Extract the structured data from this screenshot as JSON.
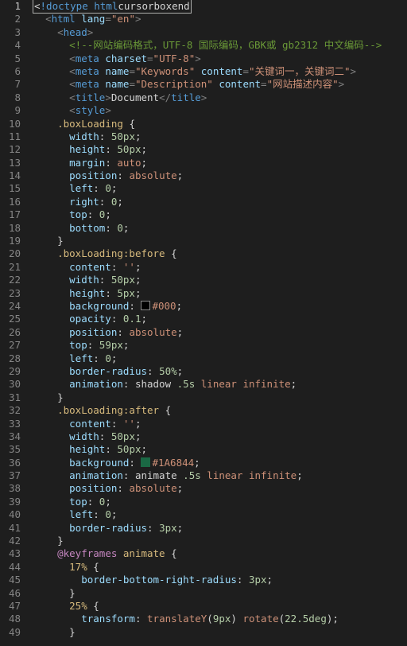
{
  "editor": {
    "line_count": 49,
    "cursor_line": 1,
    "indent_unit": "  ",
    "tokens": [
      [
        [
          0,
          "cursorbox",
          "<"
        ],
        [
          "doctype",
          "!doctype html"
        ],
        [
          0,
          "cursorboxend",
          ">"
        ]
      ],
      [
        [
          1,
          "punct",
          "<"
        ],
        [
          "tag",
          "html"
        ],
        [
          "plain",
          " "
        ],
        [
          "attr",
          "lang"
        ],
        [
          "punct",
          "="
        ],
        [
          "string",
          "\"en\""
        ],
        [
          "punct",
          ">"
        ]
      ],
      [
        [
          2,
          "punct",
          "<"
        ],
        [
          "tag",
          "head"
        ],
        [
          "punct",
          ">"
        ]
      ],
      [
        [
          3,
          "comment",
          "<!--网站编码格式，UTF-8 国际编码，GBK或 gb2312 中文编码-->"
        ]
      ],
      [
        [
          3,
          "punct",
          "<"
        ],
        [
          "tag",
          "meta"
        ],
        [
          "plain",
          " "
        ],
        [
          "attr",
          "charset"
        ],
        [
          "punct",
          "="
        ],
        [
          "string",
          "\"UTF-8\""
        ],
        [
          "punct",
          ">"
        ]
      ],
      [
        [
          3,
          "punct",
          "<"
        ],
        [
          "tag",
          "meta"
        ],
        [
          "plain",
          " "
        ],
        [
          "attr",
          "name"
        ],
        [
          "punct",
          "="
        ],
        [
          "string",
          "\"Keywords\""
        ],
        [
          "plain",
          " "
        ],
        [
          "attr",
          "content"
        ],
        [
          "punct",
          "="
        ],
        [
          "string",
          "\"关键词一，关键词二\""
        ],
        [
          "punct",
          ">"
        ]
      ],
      [
        [
          3,
          "punct",
          "<"
        ],
        [
          "tag",
          "meta"
        ],
        [
          "plain",
          " "
        ],
        [
          "attr",
          "name"
        ],
        [
          "punct",
          "="
        ],
        [
          "string",
          "\"Description\""
        ],
        [
          "plain",
          " "
        ],
        [
          "attr",
          "content"
        ],
        [
          "punct",
          "="
        ],
        [
          "string",
          "\"网站描述内容\""
        ],
        [
          "punct",
          ">"
        ]
      ],
      [
        [
          3,
          "punct",
          "<"
        ],
        [
          "tag",
          "title"
        ],
        [
          "punct",
          ">"
        ],
        [
          "plain",
          "Document"
        ],
        [
          "punct",
          "</"
        ],
        [
          "tag",
          "title"
        ],
        [
          "punct",
          ">"
        ]
      ],
      [
        [
          3,
          "punct",
          "<"
        ],
        [
          "tag",
          "style"
        ],
        [
          "punct",
          ">"
        ]
      ],
      [
        [
          2,
          "selector",
          ".boxLoading"
        ],
        [
          "plain",
          " "
        ],
        [
          "brace",
          "{"
        ]
      ],
      [
        [
          3,
          "prop",
          "width"
        ],
        [
          "colon",
          ": "
        ],
        [
          "num",
          "50"
        ],
        [
          "unit",
          "px"
        ],
        [
          "plain",
          ";"
        ]
      ],
      [
        [
          3,
          "prop",
          "height"
        ],
        [
          "colon",
          ": "
        ],
        [
          "num",
          "50"
        ],
        [
          "unit",
          "px"
        ],
        [
          "plain",
          ";"
        ]
      ],
      [
        [
          3,
          "prop",
          "margin"
        ],
        [
          "colon",
          ": "
        ],
        [
          "val",
          "auto"
        ],
        [
          "plain",
          ";"
        ]
      ],
      [
        [
          3,
          "prop",
          "position"
        ],
        [
          "colon",
          ": "
        ],
        [
          "val",
          "absolute"
        ],
        [
          "plain",
          ";"
        ]
      ],
      [
        [
          3,
          "prop",
          "left"
        ],
        [
          "colon",
          ": "
        ],
        [
          "num",
          "0"
        ],
        [
          "plain",
          ";"
        ]
      ],
      [
        [
          3,
          "prop",
          "right"
        ],
        [
          "colon",
          ": "
        ],
        [
          "num",
          "0"
        ],
        [
          "plain",
          ";"
        ]
      ],
      [
        [
          3,
          "prop",
          "top"
        ],
        [
          "colon",
          ": "
        ],
        [
          "num",
          "0"
        ],
        [
          "plain",
          ";"
        ]
      ],
      [
        [
          3,
          "prop",
          "bottom"
        ],
        [
          "colon",
          ": "
        ],
        [
          "num",
          "0"
        ],
        [
          "plain",
          ";"
        ]
      ],
      [
        [
          2,
          "brace",
          "}"
        ]
      ],
      [
        [
          2,
          "selector",
          ".boxLoading:before"
        ],
        [
          "plain",
          " "
        ],
        [
          "brace",
          "{"
        ]
      ],
      [
        [
          3,
          "prop",
          "content"
        ],
        [
          "colon",
          ": "
        ],
        [
          "val",
          "''"
        ],
        [
          "plain",
          ";"
        ]
      ],
      [
        [
          3,
          "prop",
          "width"
        ],
        [
          "colon",
          ": "
        ],
        [
          "num",
          "50"
        ],
        [
          "unit",
          "px"
        ],
        [
          "plain",
          ";"
        ]
      ],
      [
        [
          3,
          "prop",
          "height"
        ],
        [
          "colon",
          ": "
        ],
        [
          "num",
          "5"
        ],
        [
          "unit",
          "px"
        ],
        [
          "plain",
          ";"
        ]
      ],
      [
        [
          3,
          "prop",
          "background"
        ],
        [
          "colon",
          ": "
        ],
        [
          "swatch",
          "black"
        ],
        [
          "hex",
          "#000"
        ],
        [
          "plain",
          ";"
        ]
      ],
      [
        [
          3,
          "prop",
          "opacity"
        ],
        [
          "colon",
          ": "
        ],
        [
          "num",
          "0.1"
        ],
        [
          "plain",
          ";"
        ]
      ],
      [
        [
          3,
          "prop",
          "position"
        ],
        [
          "colon",
          ": "
        ],
        [
          "val",
          "absolute"
        ],
        [
          "plain",
          ";"
        ]
      ],
      [
        [
          3,
          "prop",
          "top"
        ],
        [
          "colon",
          ": "
        ],
        [
          "num",
          "59"
        ],
        [
          "unit",
          "px"
        ],
        [
          "plain",
          ";"
        ]
      ],
      [
        [
          3,
          "prop",
          "left"
        ],
        [
          "colon",
          ": "
        ],
        [
          "num",
          "0"
        ],
        [
          "plain",
          ";"
        ]
      ],
      [
        [
          3,
          "prop",
          "border-radius"
        ],
        [
          "colon",
          ": "
        ],
        [
          "num",
          "50"
        ],
        [
          "unit",
          "%"
        ],
        [
          "plain",
          ";"
        ]
      ],
      [
        [
          3,
          "prop",
          "animation"
        ],
        [
          "colon",
          ": "
        ],
        [
          "plain",
          "shadow "
        ],
        [
          "num",
          ".5"
        ],
        [
          "unit",
          "s"
        ],
        [
          "plain",
          " "
        ],
        [
          "val",
          "linear"
        ],
        [
          "plain",
          " "
        ],
        [
          "val",
          "infinite"
        ],
        [
          "plain",
          ";"
        ]
      ],
      [
        [
          2,
          "brace",
          "}"
        ]
      ],
      [
        [
          2,
          "selector",
          ".boxLoading:after"
        ],
        [
          "plain",
          " "
        ],
        [
          "brace",
          "{"
        ]
      ],
      [
        [
          3,
          "prop",
          "content"
        ],
        [
          "colon",
          ": "
        ],
        [
          "val",
          "''"
        ],
        [
          "plain",
          ";"
        ]
      ],
      [
        [
          3,
          "prop",
          "width"
        ],
        [
          "colon",
          ": "
        ],
        [
          "num",
          "50"
        ],
        [
          "unit",
          "px"
        ],
        [
          "plain",
          ";"
        ]
      ],
      [
        [
          3,
          "prop",
          "height"
        ],
        [
          "colon",
          ": "
        ],
        [
          "num",
          "50"
        ],
        [
          "unit",
          "px"
        ],
        [
          "plain",
          ";"
        ]
      ],
      [
        [
          3,
          "prop",
          "background"
        ],
        [
          "colon",
          ": "
        ],
        [
          "swatch",
          "green"
        ],
        [
          "hex",
          "#1A6844"
        ],
        [
          "plain",
          ";"
        ]
      ],
      [
        [
          3,
          "prop",
          "animation"
        ],
        [
          "colon",
          ": "
        ],
        [
          "plain",
          "animate "
        ],
        [
          "num",
          ".5"
        ],
        [
          "unit",
          "s"
        ],
        [
          "plain",
          " "
        ],
        [
          "val",
          "linear"
        ],
        [
          "plain",
          " "
        ],
        [
          "val",
          "infinite"
        ],
        [
          "plain",
          ";"
        ]
      ],
      [
        [
          3,
          "prop",
          "position"
        ],
        [
          "colon",
          ": "
        ],
        [
          "val",
          "absolute"
        ],
        [
          "plain",
          ";"
        ]
      ],
      [
        [
          3,
          "prop",
          "top"
        ],
        [
          "colon",
          ": "
        ],
        [
          "num",
          "0"
        ],
        [
          "plain",
          ";"
        ]
      ],
      [
        [
          3,
          "prop",
          "left"
        ],
        [
          "colon",
          ": "
        ],
        [
          "num",
          "0"
        ],
        [
          "plain",
          ";"
        ]
      ],
      [
        [
          3,
          "prop",
          "border-radius"
        ],
        [
          "colon",
          ": "
        ],
        [
          "num",
          "3"
        ],
        [
          "unit",
          "px"
        ],
        [
          "plain",
          ";"
        ]
      ],
      [
        [
          2,
          "brace",
          "}"
        ]
      ],
      [
        [
          2,
          "at",
          "@keyframes"
        ],
        [
          "plain",
          " "
        ],
        [
          "selector",
          "animate"
        ],
        [
          "plain",
          " "
        ],
        [
          "brace",
          "{"
        ]
      ],
      [
        [
          3,
          "pct",
          "17%"
        ],
        [
          "plain",
          " "
        ],
        [
          "brace",
          "{"
        ]
      ],
      [
        [
          4,
          "prop",
          "border-bottom-right-radius"
        ],
        [
          "colon",
          ": "
        ],
        [
          "num",
          "3"
        ],
        [
          "unit",
          "px"
        ],
        [
          "plain",
          ";"
        ]
      ],
      [
        [
          3,
          "brace",
          "}"
        ]
      ],
      [
        [
          3,
          "pct",
          "25%"
        ],
        [
          "plain",
          " "
        ],
        [
          "brace",
          "{"
        ]
      ],
      [
        [
          4,
          "prop",
          "transform"
        ],
        [
          "colon",
          ": "
        ],
        [
          "val",
          "translateY"
        ],
        [
          "plain",
          "("
        ],
        [
          "num",
          "9"
        ],
        [
          "unit",
          "px"
        ],
        [
          "plain",
          ") "
        ],
        [
          "val",
          "rotate"
        ],
        [
          "plain",
          "("
        ],
        [
          "num",
          "22.5"
        ],
        [
          "unit",
          "deg"
        ],
        [
          "plain",
          ");"
        ]
      ],
      [
        [
          3,
          "brace",
          "}"
        ]
      ]
    ]
  }
}
